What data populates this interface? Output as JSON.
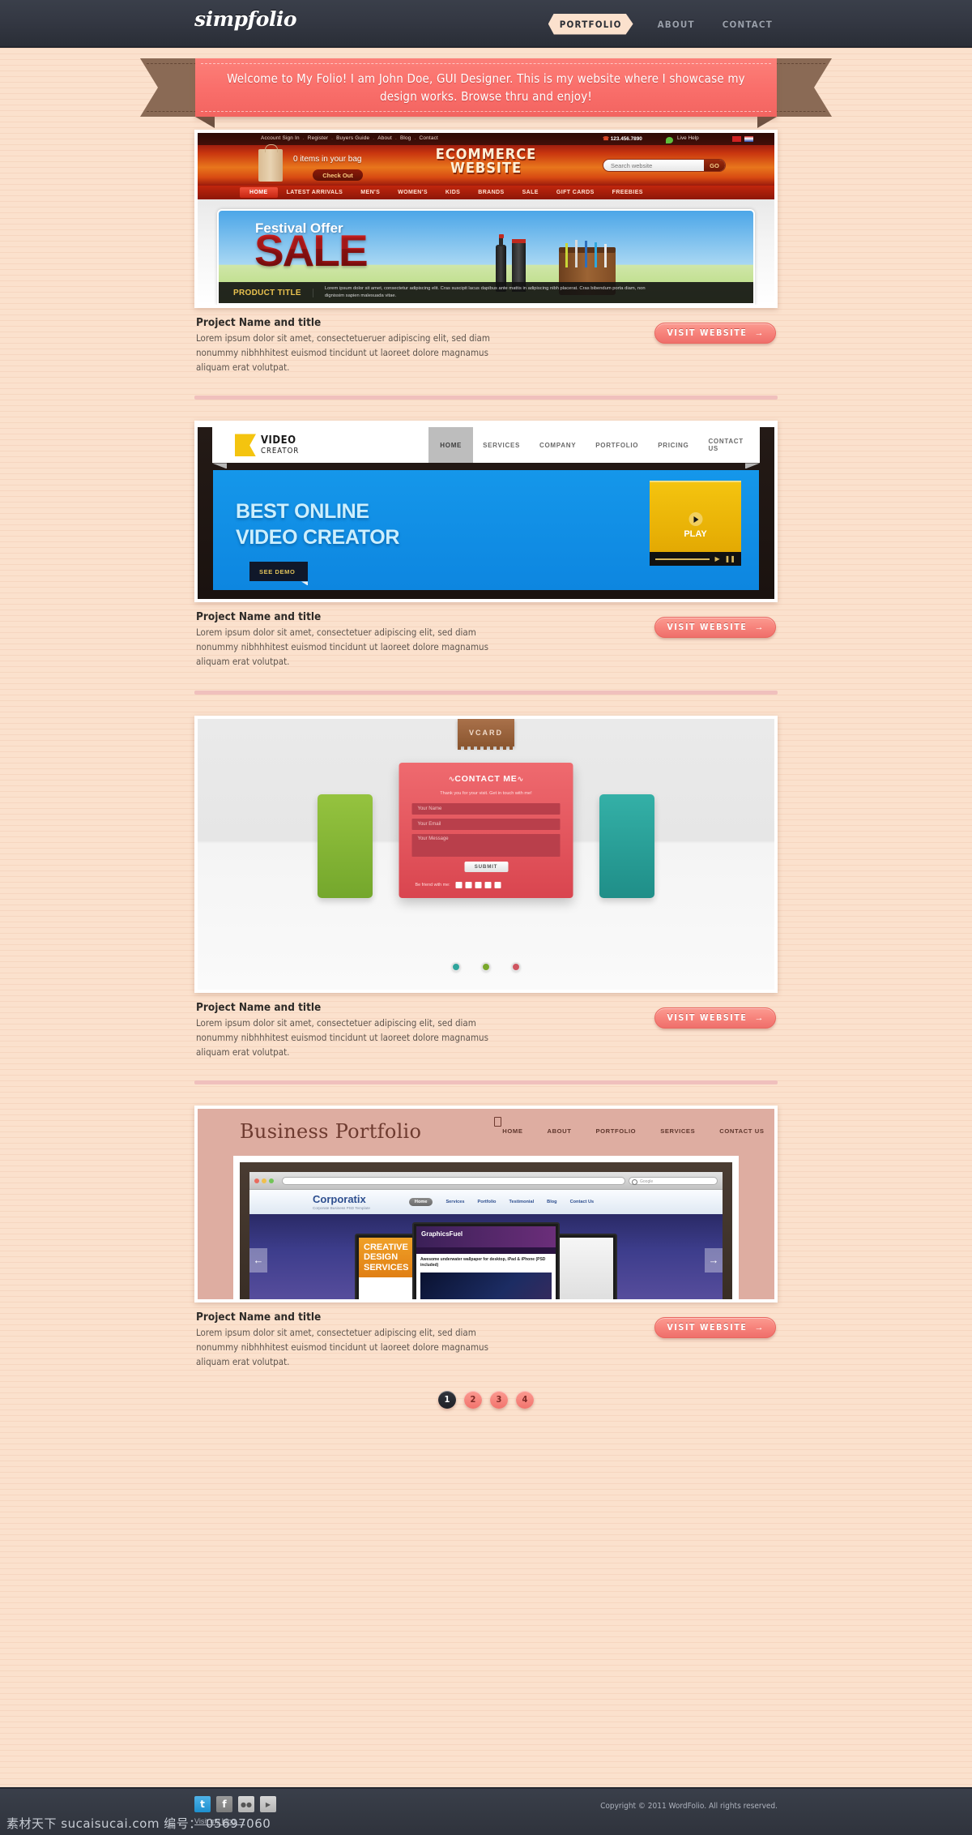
{
  "header": {
    "logo": "simpfolio",
    "nav": [
      {
        "label": "PORTFOLIO",
        "active": true
      },
      {
        "label": "ABOUT",
        "active": false
      },
      {
        "label": "CONTACT",
        "active": false
      }
    ]
  },
  "ribbon": {
    "text": "Welcome to My Folio! I am John Doe, GUI Designer. This is my website where I showcase my design works. Browse thru and enjoy!"
  },
  "projects": [
    {
      "title": "Project Name and title",
      "description": "Lorem ipsum dolor sit amet, consectetueruer adipiscing elit, sed diam nonummy nibhhhitest euismod tincidunt ut laoreet dolore magnamus aliquam erat volutpat.",
      "button": "VISIT WEBSITE",
      "arrow": "→"
    },
    {
      "title": "Project Name and title",
      "description": "Lorem ipsum dolor sit amet, consectetuer adipiscing elit, sed diam nonummy nibhhhitest euismod tincidunt ut laoreet dolore magnamus aliquam erat volutpat.",
      "button": "VISIT WEBSITE",
      "arrow": "→"
    },
    {
      "title": "Project Name and title",
      "description": "Lorem ipsum dolor sit amet, consectetuer adipiscing elit, sed diam nonummy nibhhhitest euismod tincidunt ut laoreet dolore magnamus aliquam erat volutpat.",
      "button": "VISIT WEBSITE",
      "arrow": "→"
    },
    {
      "title": "Project Name and title",
      "description": "Lorem ipsum dolor sit amet, consectetuer adipiscing elit, sed diam nonummy nibhhhitest euismod tincidunt ut laoreet dolore magnamus aliquam erat volutpat.",
      "button": "VISIT WEBSITE",
      "arrow": "→"
    }
  ],
  "shot_ecommerce": {
    "toplinks": [
      "Account Sign In",
      "Register",
      "Buyers Guide",
      "About",
      "Blog",
      "Contact"
    ],
    "phone": "123.456.7890",
    "live_help": "Live Help",
    "bag_text": "0 items in your bag",
    "checkout": "Check Out",
    "title_line1": "ECOMMERCE",
    "title_line2": "WEBSITE",
    "search_placeholder": "Search website",
    "go": "GO",
    "nav": [
      "HOME",
      "LATEST ARRIVALS",
      "MEN'S",
      "WOMEN'S",
      "KIDS",
      "BRANDS",
      "SALE",
      "GIFT CARDS",
      "FREEBIES"
    ],
    "hero_kicker": "Festival Offer",
    "hero_title": "SALE",
    "product_title": "PRODUCT TITLE",
    "product_desc": "Lorem ipsum dolor sit amet, consectetur adipiscing elit. Cras suscipit lacus dapibus ante mattis in adipiscing nibh placerat. Cras bibendum porta diam, non dignissim sapien malesuada vitae."
  },
  "shot_video": {
    "logo_line1": "VIDEO",
    "logo_line2": "CREATOR",
    "nav": [
      "HOME",
      "SERVICES",
      "COMPANY",
      "PORTFOLIO",
      "PRICING",
      "CONTACT US"
    ],
    "headline_line1": "BEST ONLINE",
    "headline_line2": "VIDEO CREATOR",
    "demo_button": "SEE DEMO",
    "play_label": "PLAY"
  },
  "shot_vcard": {
    "tab": "VCARD",
    "card_title": "CONTACT ME",
    "card_sub": "Thank you for your visit. Get in touch with me!",
    "fields": [
      "Your Name",
      "Your Email",
      "Your Message"
    ],
    "submit": "SUBMIT",
    "social_label": "Be friend with me:"
  },
  "shot_business": {
    "title": "Business Portfolio",
    "nav": [
      "HOME",
      "ABOUT",
      "PORTFOLIO",
      "SERVICES",
      "CONTACT US"
    ],
    "browser_search": "Google",
    "site_name": "Corporatix",
    "site_tagline": "Corporate Business PSD Template",
    "site_nav": [
      "Home",
      "Services",
      "Portfolio",
      "Testimonial",
      "Blog",
      "Contact Us"
    ],
    "card_left": "CREATIVE DESIGN SERVICES",
    "card_center_brand": "GraphicsFuel",
    "card_center_headline": "Awesome underwater wallpaper for desktop, iPad & iPhone (PSD included)",
    "arrow_left": "←",
    "arrow_right": "→"
  },
  "pagination": {
    "pages": [
      "1",
      "2",
      "3",
      "4"
    ],
    "current": "1"
  },
  "footer": {
    "social": [
      "twitter-icon",
      "facebook-icon",
      "flickr-icon",
      "youtube-icon"
    ],
    "social_glyphs": [
      "t",
      "f",
      "●●",
      "▶"
    ],
    "blog_link": "Visit my blog",
    "blog_arrow": "→",
    "copyright": "Copyright © 2011 WordFolio. All rights reserved."
  },
  "watermark": "素材天下 sucaisucai.com  编号： 05697060",
  "colors": {
    "bg": "#fbe1cd",
    "accent": "#f2736d",
    "ribbon": "#fa6f6b",
    "ribbon_tail": "#8a6a55",
    "dark": "#2f333c"
  }
}
